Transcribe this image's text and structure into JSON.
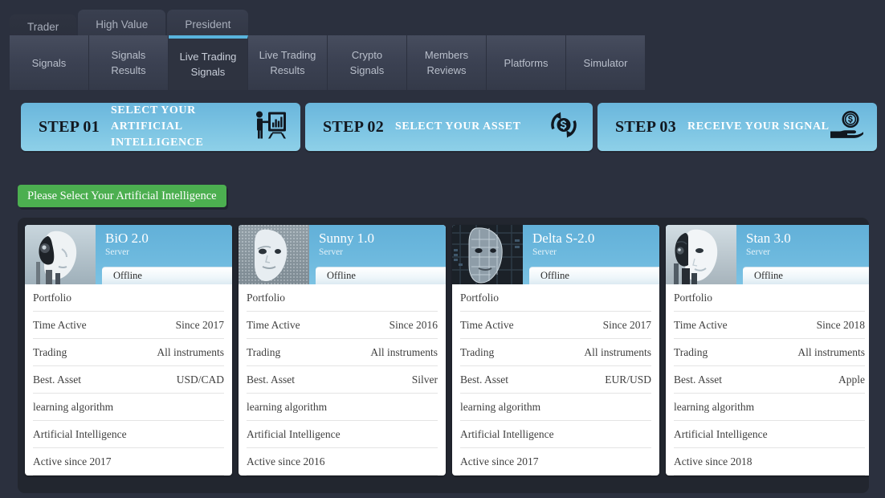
{
  "top_tabs": [
    {
      "label": "Trader"
    },
    {
      "label": "High Value"
    },
    {
      "label": "President"
    }
  ],
  "nav": {
    "items": [
      {
        "line1": "Signals",
        "line2": "",
        "active": false
      },
      {
        "line1": "Signals",
        "line2": "Results",
        "active": false
      },
      {
        "line1": "Live Trading",
        "line2": "Signals",
        "active": true
      },
      {
        "line1": "Live Trading",
        "line2": "Results",
        "active": false
      },
      {
        "line1": "Crypto",
        "line2": "Signals",
        "active": false
      },
      {
        "line1": "Members",
        "line2": "Reviews",
        "active": false
      },
      {
        "line1": "Platforms",
        "line2": "",
        "active": false
      },
      {
        "line1": "Simulator",
        "line2": "",
        "active": false
      }
    ],
    "active_accent": "#59b4dd"
  },
  "steps": [
    {
      "num": "STEP 01",
      "label": "SELECT YOUR ARTIFICIAL INTELLIGENCE",
      "icon": "presenter-chart-icon"
    },
    {
      "num": "STEP 02",
      "label": "SELECT YOUR ASSET",
      "icon": "currency-exchange-icon"
    },
    {
      "num": "STEP 03",
      "label": "RECEIVE YOUR SIGNAL",
      "icon": "hand-coin-icon"
    }
  ],
  "select_button": {
    "label": "Please Select Your Artificial Intelligence",
    "color": "#4caf50"
  },
  "cards": [
    {
      "title": "BiO 2.0",
      "subtitle": "Server",
      "status": "Offline",
      "avatar": "robot-head-avatar",
      "rows": [
        {
          "key": "Portfolio",
          "value": ""
        },
        {
          "key": "Time Active",
          "value": "Since 2017"
        },
        {
          "key": "Trading",
          "value": "All instruments"
        },
        {
          "key": "Best. Asset",
          "value": "USD/CAD"
        },
        {
          "key": "learning algorithm",
          "value": ""
        },
        {
          "key": "Artificial Intelligence",
          "value": ""
        },
        {
          "key": "Active since 2017",
          "value": ""
        }
      ]
    },
    {
      "title": "Sunny 1.0",
      "subtitle": "Server",
      "status": "Offline",
      "avatar": "digital-face-avatar",
      "rows": [
        {
          "key": "Portfolio",
          "value": ""
        },
        {
          "key": "Time Active",
          "value": "Since 2016"
        },
        {
          "key": "Trading",
          "value": "All instruments"
        },
        {
          "key": "Best. Asset",
          "value": "Silver"
        },
        {
          "key": "learning algorithm",
          "value": ""
        },
        {
          "key": "Artificial Intelligence",
          "value": ""
        },
        {
          "key": "Active since 2016",
          "value": ""
        }
      ]
    },
    {
      "title": "Delta S-2.0",
      "subtitle": "Server",
      "status": "Offline",
      "avatar": "circuit-face-avatar",
      "rows": [
        {
          "key": "Portfolio",
          "value": ""
        },
        {
          "key": "Time Active",
          "value": "Since 2017"
        },
        {
          "key": "Trading",
          "value": "All instruments"
        },
        {
          "key": "Best. Asset",
          "value": "EUR/USD"
        },
        {
          "key": "learning algorithm",
          "value": ""
        },
        {
          "key": "Artificial Intelligence",
          "value": ""
        },
        {
          "key": "Active since 2017",
          "value": ""
        }
      ]
    },
    {
      "title": "Stan 3.0",
      "subtitle": "Server",
      "status": "Offline",
      "avatar": "android-woman-avatar",
      "rows": [
        {
          "key": "Portfolio",
          "value": ""
        },
        {
          "key": "Time Active",
          "value": "Since 2018"
        },
        {
          "key": "Trading",
          "value": "All instruments"
        },
        {
          "key": "Best. Asset",
          "value": "Apple"
        },
        {
          "key": "learning algorithm",
          "value": ""
        },
        {
          "key": "Artificial Intelligence",
          "value": ""
        },
        {
          "key": "Active since 2018",
          "value": ""
        }
      ]
    }
  ]
}
